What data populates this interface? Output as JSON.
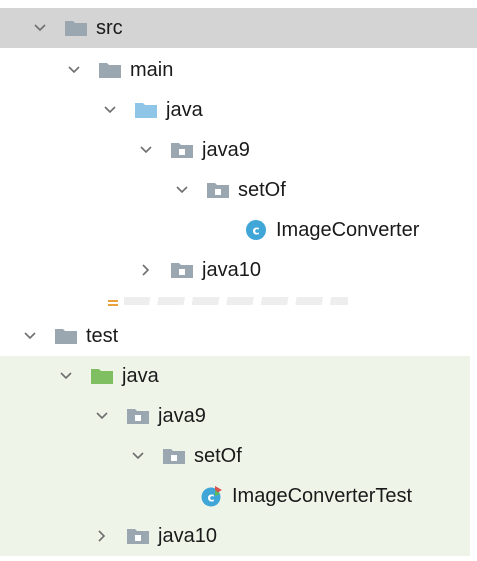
{
  "tree": {
    "src": "src",
    "main": "main",
    "main_java": "java",
    "main_java9": "java9",
    "main_setOf": "setOf",
    "main_class": "ImageConverter",
    "main_java10": "java10",
    "test": "test",
    "test_java": "java",
    "test_java9": "java9",
    "test_setOf": "setOf",
    "test_class": "ImageConverterTest",
    "test_java10": "java10"
  },
  "icons": {
    "folder": "folder-icon",
    "source_root": "source-root-folder-icon",
    "test_root": "test-root-folder-icon",
    "package": "package-icon",
    "class": "class-icon",
    "test_class": "test-class-icon",
    "expanded": "chevron-down-icon",
    "collapsed": "chevron-right-icon"
  },
  "colors": {
    "selection": "#d4d4d4",
    "test_background": "#eef5e8",
    "folder_gray": "#9aa7b0",
    "source_root_blue": "#8fc6e8",
    "test_root_green": "#7fbf62",
    "class_blue": "#40a6d8"
  }
}
